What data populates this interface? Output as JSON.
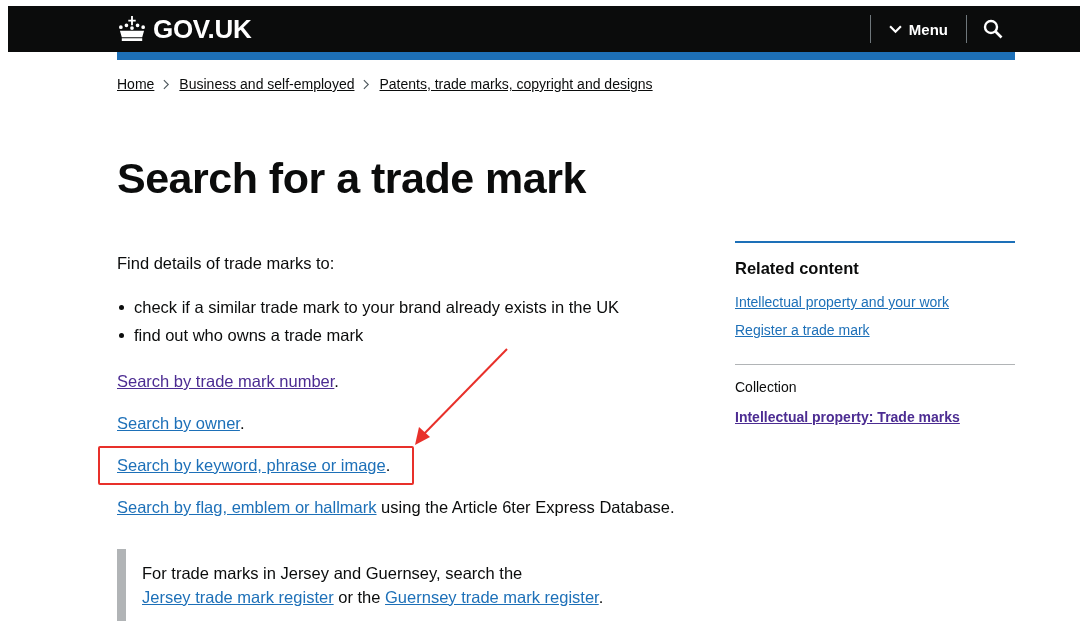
{
  "header": {
    "logo": "GOV.UK",
    "menu": "Menu"
  },
  "breadcrumbs": [
    "Home",
    "Business and self-employed",
    "Patents, trade marks, copyright and designs"
  ],
  "title": "Search for a trade mark",
  "intro": "Find details of trade marks to:",
  "bullets": [
    "check if a similar trade mark to your brand already exists in the UK",
    "find out who owns a trade mark"
  ],
  "search_options": [
    {
      "highlighted": false,
      "segments": [
        {
          "kind": "link",
          "text": "Search by trade mark number",
          "visited": true
        },
        {
          "kind": "text",
          "text": "."
        }
      ]
    },
    {
      "highlighted": false,
      "segments": [
        {
          "kind": "link",
          "text": "Search by owner",
          "visited": false
        },
        {
          "kind": "text",
          "text": "."
        }
      ]
    },
    {
      "highlighted": true,
      "segments": [
        {
          "kind": "link",
          "text": "Search by keyword, phrase or image",
          "visited": false
        },
        {
          "kind": "text",
          "text": "."
        }
      ]
    },
    {
      "highlighted": false,
      "segments": [
        {
          "kind": "link",
          "text": "Search by flag, emblem or hallmark",
          "visited": false
        },
        {
          "kind": "text",
          "text": " using the Article 6ter Express Database."
        }
      ]
    }
  ],
  "inset": {
    "segments": [
      {
        "kind": "text",
        "text": "For trade marks in Jersey and Guernsey, search the "
      },
      {
        "kind": "link",
        "text": "Jersey trade mark register",
        "visited": false
      },
      {
        "kind": "text",
        "text": " or the "
      },
      {
        "kind": "link",
        "text": "Guernsey trade mark register",
        "visited": false
      },
      {
        "kind": "text",
        "text": "."
      }
    ]
  },
  "related_content": {
    "heading": "Related content",
    "links": [
      {
        "label": "Intellectual property and your work",
        "visited": false
      },
      {
        "label": "Register a trade mark",
        "visited": false
      }
    ]
  },
  "collection": {
    "heading": "Collection",
    "link": {
      "label": "Intellectual property: Trade marks",
      "visited": true
    }
  }
}
